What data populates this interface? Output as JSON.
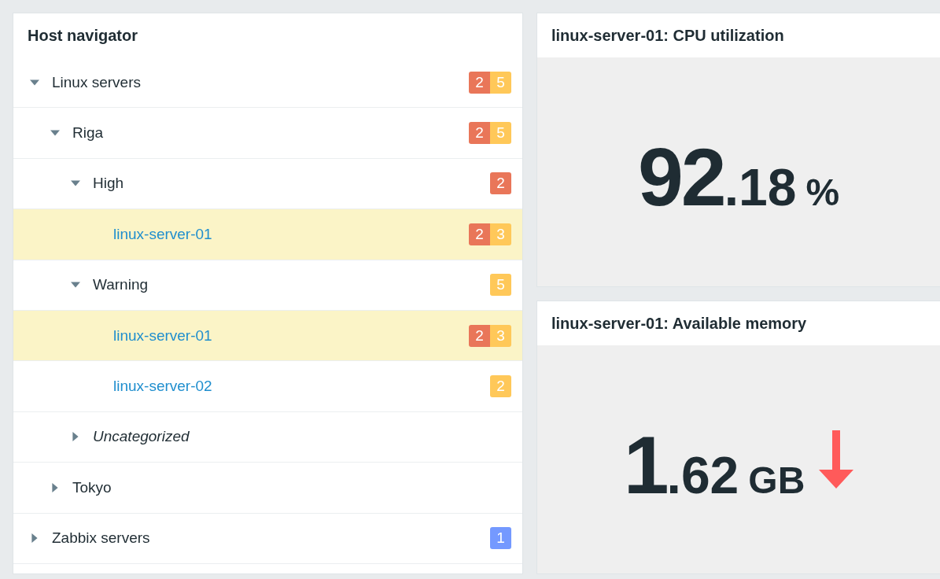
{
  "navigator": {
    "title": "Host navigator",
    "tree": [
      {
        "label": "Linux servers",
        "kind": "group",
        "expanded": true,
        "badges": [
          {
            "count": "2",
            "color": "#e97659"
          },
          {
            "count": "5",
            "color": "#ffc859"
          }
        ],
        "children": [
          {
            "label": "Riga",
            "kind": "group",
            "expanded": true,
            "badges": [
              {
                "count": "2",
                "color": "#e97659"
              },
              {
                "count": "5",
                "color": "#ffc859"
              }
            ],
            "children": [
              {
                "label": "High",
                "kind": "group",
                "expanded": true,
                "badges": [
                  {
                    "count": "2",
                    "color": "#e97659"
                  }
                ],
                "children": [
                  {
                    "label": "linux-server-01",
                    "kind": "host",
                    "selected": true,
                    "badges": [
                      {
                        "count": "2",
                        "color": "#e97659"
                      },
                      {
                        "count": "3",
                        "color": "#ffc859"
                      }
                    ]
                  }
                ]
              },
              {
                "label": "Warning",
                "kind": "group",
                "expanded": true,
                "badges": [
                  {
                    "count": "5",
                    "color": "#ffc859"
                  }
                ],
                "children": [
                  {
                    "label": "linux-server-01",
                    "kind": "host",
                    "selected": true,
                    "badges": [
                      {
                        "count": "2",
                        "color": "#e97659"
                      },
                      {
                        "count": "3",
                        "color": "#ffc859"
                      }
                    ]
                  },
                  {
                    "label": "linux-server-02",
                    "kind": "host",
                    "selected": false,
                    "badges": [
                      {
                        "count": "2",
                        "color": "#ffc859"
                      }
                    ]
                  }
                ]
              },
              {
                "label": "Uncategorized",
                "kind": "uncategorized",
                "expanded": false
              }
            ]
          },
          {
            "label": "Tokyo",
            "kind": "group",
            "expanded": false
          }
        ]
      },
      {
        "label": "Zabbix servers",
        "kind": "group",
        "expanded": false,
        "badges": [
          {
            "count": "1",
            "color": "#7499ff"
          }
        ]
      }
    ]
  },
  "widgets": [
    {
      "title": "linux-server-01: CPU utilization",
      "whole": "92",
      "decimal": ".18",
      "unit": "%",
      "falling": false
    },
    {
      "title": "linux-server-01: Available memory",
      "whole": "1",
      "decimal": ".62",
      "unit": "GB",
      "falling": true
    }
  ]
}
